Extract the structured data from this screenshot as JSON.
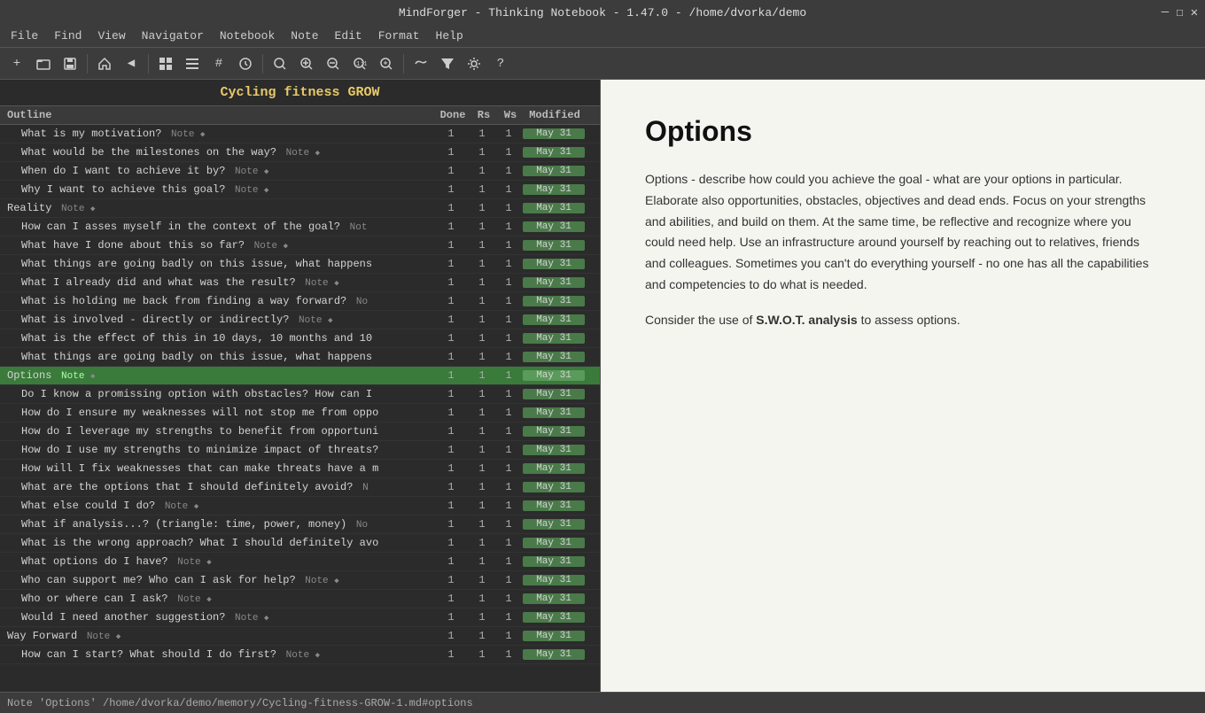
{
  "titlebar": {
    "title": "MindForger - Thinking Notebook - 1.47.0 - /home/dvorka/demo",
    "controls": [
      "—",
      "☐",
      "✕"
    ]
  },
  "menubar": {
    "items": [
      "File",
      "Find",
      "View",
      "Navigator",
      "Notebook",
      "Note",
      "Edit",
      "Format",
      "Help"
    ]
  },
  "toolbar": {
    "buttons": [
      {
        "name": "new-icon",
        "symbol": "+"
      },
      {
        "name": "open-icon",
        "symbol": "📁"
      },
      {
        "name": "save-icon",
        "symbol": "💾"
      },
      {
        "name": "home-icon",
        "symbol": "🏠"
      },
      {
        "name": "back-icon",
        "symbol": "◀"
      },
      {
        "name": "grid-icon",
        "symbol": "⊞"
      },
      {
        "name": "list-icon",
        "symbol": "☰"
      },
      {
        "name": "tags-icon",
        "symbol": "#"
      },
      {
        "name": "calendar-icon",
        "symbol": "⏱"
      },
      {
        "name": "zoom-fit-icon",
        "symbol": "⊡"
      },
      {
        "name": "zoom-in-icon",
        "symbol": "🔍"
      },
      {
        "name": "zoom-out-icon",
        "symbol": "🔎"
      },
      {
        "name": "zoom-reset-icon",
        "symbol": "⊙"
      },
      {
        "name": "zoom-full-icon",
        "symbol": "⊕"
      },
      {
        "name": "neural-icon",
        "symbol": "〜"
      },
      {
        "name": "filter-icon",
        "symbol": "⊿"
      },
      {
        "name": "settings-icon",
        "symbol": "⚙"
      },
      {
        "name": "help-icon",
        "symbol": "?"
      }
    ]
  },
  "outline": {
    "title": "Cycling fitness GROW",
    "headers": [
      "Outline",
      "Done",
      "Rs",
      "Ws",
      "Modified"
    ],
    "rows": [
      {
        "indent": true,
        "text": "What is my motivation?",
        "note": "Note",
        "diamond": true,
        "done": "1",
        "rs": "1",
        "ws": "1",
        "mod": "May 31"
      },
      {
        "indent": true,
        "text": "What would be the milestones on the way?",
        "note": "Note",
        "diamond": true,
        "done": "1",
        "rs": "1",
        "ws": "1",
        "mod": "May 31"
      },
      {
        "indent": true,
        "text": "When do I want to achieve it by?",
        "note": "Note",
        "diamond": true,
        "done": "1",
        "rs": "1",
        "ws": "1",
        "mod": "May 31"
      },
      {
        "indent": true,
        "text": "Why I want to achieve this goal?",
        "note": "Note",
        "diamond": true,
        "done": "1",
        "rs": "1",
        "ws": "1",
        "mod": "May 31"
      },
      {
        "indent": false,
        "text": "Reality",
        "note": "Note",
        "diamond": true,
        "done": "1",
        "rs": "1",
        "ws": "1",
        "mod": "May 31"
      },
      {
        "indent": true,
        "text": "How can I asses myself in the context of the goal?",
        "note": "Not",
        "diamond": false,
        "done": "1",
        "rs": "1",
        "ws": "1",
        "mod": "May 31"
      },
      {
        "indent": true,
        "text": "What have I done about this so far?",
        "note": "Note",
        "diamond": true,
        "done": "1",
        "rs": "1",
        "ws": "1",
        "mod": "May 31"
      },
      {
        "indent": true,
        "text": "What things are going badly on this issue, what happens",
        "note": "",
        "diamond": false,
        "done": "1",
        "rs": "1",
        "ws": "1",
        "mod": "May 31"
      },
      {
        "indent": true,
        "text": "What I already did and what was the result?",
        "note": "Note",
        "diamond": true,
        "done": "1",
        "rs": "1",
        "ws": "1",
        "mod": "May 31"
      },
      {
        "indent": true,
        "text": "What is holding me back from finding a way forward?",
        "note": "No",
        "diamond": false,
        "done": "1",
        "rs": "1",
        "ws": "1",
        "mod": "May 31"
      },
      {
        "indent": true,
        "text": "What is involved - directly or indirectly?",
        "note": "Note",
        "diamond": true,
        "done": "1",
        "rs": "1",
        "ws": "1",
        "mod": "May 31"
      },
      {
        "indent": true,
        "text": "What is the effect of this in 10 days, 10 months and 10",
        "note": "",
        "diamond": false,
        "done": "1",
        "rs": "1",
        "ws": "1",
        "mod": "May 31"
      },
      {
        "indent": true,
        "text": "What things are going badly on this issue, what happens",
        "note": "",
        "diamond": false,
        "done": "1",
        "rs": "1",
        "ws": "1",
        "mod": "May 31"
      },
      {
        "indent": false,
        "text": "Options",
        "note": "Note",
        "diamond": true,
        "done": "1",
        "rs": "1",
        "ws": "1",
        "mod": "May 31",
        "selected": true
      },
      {
        "indent": true,
        "text": "Do I know a promissing option with obstacles? How can I",
        "note": "",
        "diamond": false,
        "done": "1",
        "rs": "1",
        "ws": "1",
        "mod": "May 31"
      },
      {
        "indent": true,
        "text": "How do I ensure my weaknesses will not stop me from oppo",
        "note": "",
        "diamond": false,
        "done": "1",
        "rs": "1",
        "ws": "1",
        "mod": "May 31"
      },
      {
        "indent": true,
        "text": "How do I leverage my strengths to benefit from opportuni",
        "note": "",
        "diamond": false,
        "done": "1",
        "rs": "1",
        "ws": "1",
        "mod": "May 31"
      },
      {
        "indent": true,
        "text": "How do I use my strengths to minimize impact of threats?",
        "note": "",
        "diamond": false,
        "done": "1",
        "rs": "1",
        "ws": "1",
        "mod": "May 31"
      },
      {
        "indent": true,
        "text": "How will I fix weaknesses that can make threats have a m",
        "note": "",
        "diamond": false,
        "done": "1",
        "rs": "1",
        "ws": "1",
        "mod": "May 31"
      },
      {
        "indent": true,
        "text": "What are the options that I should definitely avoid?",
        "note": "N",
        "diamond": false,
        "done": "1",
        "rs": "1",
        "ws": "1",
        "mod": "May 31"
      },
      {
        "indent": true,
        "text": "What else could I do?",
        "note": "Note",
        "diamond": true,
        "done": "1",
        "rs": "1",
        "ws": "1",
        "mod": "May 31"
      },
      {
        "indent": true,
        "text": "What if analysis...? (triangle: time, power, money)",
        "note": "No",
        "diamond": false,
        "done": "1",
        "rs": "1",
        "ws": "1",
        "mod": "May 31"
      },
      {
        "indent": true,
        "text": "What is the wrong approach? What I should definitely avo",
        "note": "",
        "diamond": false,
        "done": "1",
        "rs": "1",
        "ws": "1",
        "mod": "May 31"
      },
      {
        "indent": true,
        "text": "What options do I have?",
        "note": "Note",
        "diamond": true,
        "done": "1",
        "rs": "1",
        "ws": "1",
        "mod": "May 31"
      },
      {
        "indent": true,
        "text": "Who can support me? Who can I ask for help?",
        "note": "Note",
        "diamond": true,
        "done": "1",
        "rs": "1",
        "ws": "1",
        "mod": "May 31"
      },
      {
        "indent": true,
        "text": "Who or where can I ask?",
        "note": "Note",
        "diamond": true,
        "done": "1",
        "rs": "1",
        "ws": "1",
        "mod": "May 31"
      },
      {
        "indent": true,
        "text": "Would I need another suggestion?",
        "note": "Note",
        "diamond": true,
        "done": "1",
        "rs": "1",
        "ws": "1",
        "mod": "May 31"
      },
      {
        "indent": false,
        "text": "Way Forward",
        "note": "Note",
        "diamond": true,
        "done": "1",
        "rs": "1",
        "ws": "1",
        "mod": "May 31"
      },
      {
        "indent": true,
        "text": "How can I start? What should I do first?",
        "note": "Note",
        "diamond": true,
        "done": "1",
        "rs": "1",
        "ws": "1",
        "mod": "May 31"
      }
    ]
  },
  "content": {
    "title": "Options",
    "paragraphs": [
      "Options - describe how could you achieve the goal - what are your options in particular. Elaborate also opportunities, obstacles, objectives and dead ends. Focus on your strengths and abilities, and build on them. At the same time, be reflective and recognize where you could need help. Use an infrastructure around yourself by reaching out to relatives, friends and colleagues. Sometimes you can't do everything yourself - no one has all the capabilities and competencies to do what is needed.",
      "Consider the use of S.W.O.T. analysis to assess options.",
      "swot_bold_start",
      "swot_bold_end"
    ],
    "para1": "Options - describe how could you achieve the goal - what are your options in particular. Elaborate also opportunities, obstacles, objectives and dead ends. Focus on your strengths and abilities, and build on them. At the same time, be reflective and recognize where you could need help. Use an infrastructure around yourself by reaching out to relatives, friends and colleagues. Sometimes you can't do everything yourself - no one has all the capabilities and competencies to do what is needed.",
    "para2_prefix": "Consider the use of ",
    "para2_bold": "S.W.O.T. analysis",
    "para2_suffix": " to assess options."
  },
  "statusbar": {
    "text": "Note 'Options'   /home/dvorka/demo/memory/Cycling-fitness-GROW-1.md#options"
  }
}
